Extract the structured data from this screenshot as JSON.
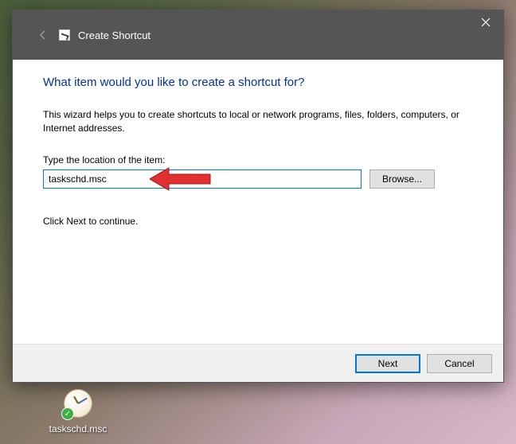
{
  "dialog": {
    "title": "Create Shortcut",
    "heading": "What item would you like to create a shortcut for?",
    "description": "This wizard helps you to create shortcuts to local or network programs, files, folders, computers, or Internet addresses.",
    "location_label": "Type the location of the item:",
    "location_value": "taskschd.msc",
    "browse_label": "Browse...",
    "continue_text": "Click Next to continue.",
    "next_label": "Next",
    "cancel_label": "Cancel"
  },
  "desktop": {
    "shortcut_label": "taskschd.msc"
  }
}
